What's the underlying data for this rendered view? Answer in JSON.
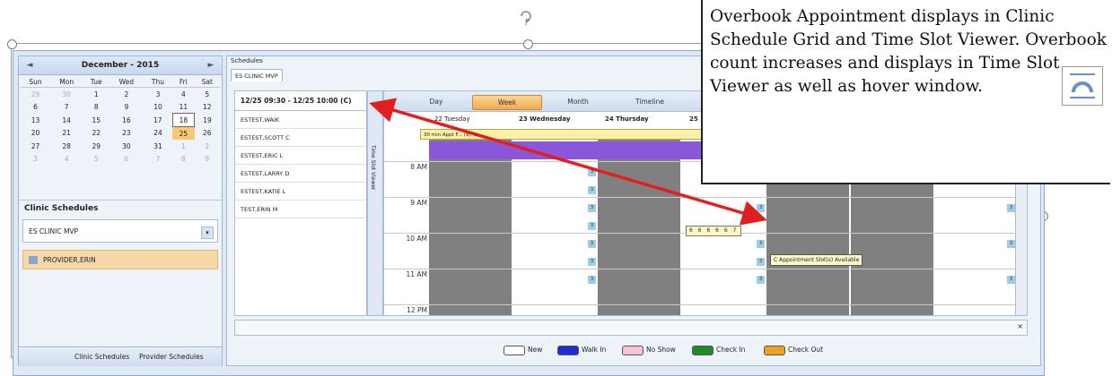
{
  "calendar": {
    "title": "December - 2015",
    "prev": "◄",
    "next": "►",
    "weekdays": [
      "Sun",
      "Mon",
      "Tue",
      "Wed",
      "Thu",
      "Fri",
      "Sat"
    ],
    "weeks": [
      [
        "29",
        "30",
        "1",
        "2",
        "3",
        "4",
        "5"
      ],
      [
        "6",
        "7",
        "8",
        "9",
        "10",
        "11",
        "12"
      ],
      [
        "13",
        "14",
        "15",
        "16",
        "17",
        "18",
        "19"
      ],
      [
        "20",
        "21",
        "22",
        "23",
        "24",
        "25",
        "26"
      ],
      [
        "27",
        "28",
        "29",
        "30",
        "31",
        "1",
        "2"
      ],
      [
        "3",
        "4",
        "5",
        "6",
        "7",
        "8",
        "9"
      ]
    ]
  },
  "clinic": {
    "section_title": "Clinic Schedules",
    "selected_clinic": "ES CLINIC MVP",
    "provider": "PROVIDER,ERIN"
  },
  "left_tabs": {
    "clinic": "Clinic Schedules",
    "provider": "Provider Schedules"
  },
  "schedules": {
    "panel_title": "Schedules",
    "tab": "ES CLINIC MVP",
    "slot_header": "12/25 09:30 - 12/25 10:00 (C)",
    "patients": [
      "ESTEST,WAIK",
      "ESTEST,SCOTT C",
      "ESTEST,ERIC L",
      "ESTEST,LARRY D",
      "ESTEST,KATIE L",
      "TEST,ERIN M"
    ],
    "time_slot_viewer": "Time Slot Viewer"
  },
  "views": [
    "Day",
    "Week",
    "Month",
    "Timeline"
  ],
  "active_view": "Week",
  "days": [
    "22 Tuesday",
    "23 Wednesday",
    "24 Thursday",
    "25"
  ],
  "hours": [
    "8 AM",
    "9 AM",
    "10 AM",
    "11 AM",
    "12 PM"
  ],
  "appointment_text": "30 min Appt F... (9): 1",
  "overbook_cells": "6 6 6 6 6 7",
  "hover_text": "C Appointment Slot(s) Available",
  "legend": [
    {
      "label": "New",
      "color": "#ffffff"
    },
    {
      "label": "Walk In",
      "color": "#1a2fd6"
    },
    {
      "label": "No Show",
      "color": "#f7c3d3"
    },
    {
      "label": "Check In",
      "color": "#1f8a2a"
    },
    {
      "label": "Check Out",
      "color": "#f0a020"
    }
  ],
  "callout_text": "Overbook Appointment displays in Clinic Schedule Grid and Time Slot Viewer. Overbook count increases and displays in Time Slot Viewer as well as hover window.",
  "colors": {
    "arrow": "#e02020",
    "selected_day": "#f6c97a",
    "purple_block": "#8a57d9",
    "grey_block": "#808080"
  }
}
